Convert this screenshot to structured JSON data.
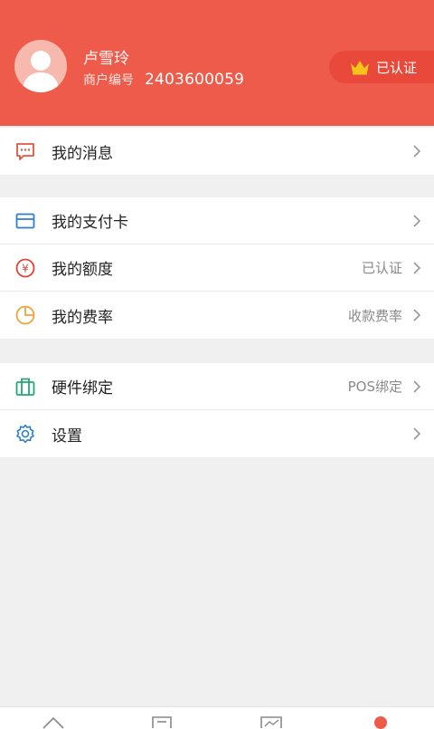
{
  "profile": {
    "name": "卢雪玲",
    "merchant_label": "商户编号",
    "merchant_number": "2403600059",
    "verified_label": "已认证"
  },
  "menu": {
    "messages": {
      "label": "我的消息"
    },
    "cards": {
      "label": "我的支付卡"
    },
    "quota": {
      "label": "我的额度",
      "value": "已认证"
    },
    "rate": {
      "label": "我的费率",
      "value": "收款费率"
    },
    "hardware": {
      "label": "硬件绑定",
      "value": "POS绑定"
    },
    "settings": {
      "label": "设置"
    }
  },
  "colors": {
    "header": "#ef5b4a",
    "message_icon": "#e2553f",
    "card_icon": "#2f7fc8",
    "quota_icon": "#d9453a",
    "rate_icon": "#f2a23b",
    "hardware_icon": "#24a873",
    "settings_icon": "#2f7fc8"
  },
  "tabbar": {
    "icons": [
      "home-icon",
      "list-icon",
      "chart-icon",
      "profile-icon"
    ]
  }
}
